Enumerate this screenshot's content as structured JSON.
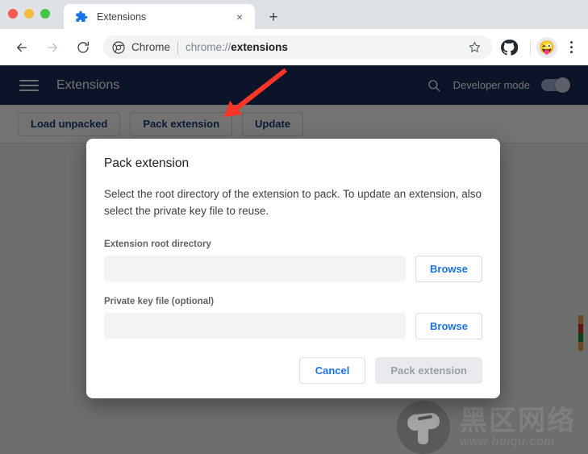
{
  "window": {
    "traffic_lights": [
      "close",
      "minimize",
      "maximize"
    ]
  },
  "tabstrip": {
    "tab": {
      "favicon": "puzzle-piece-icon",
      "title": "Extensions",
      "close_label": "×"
    },
    "new_tab_label": "+"
  },
  "navbar": {
    "back_label": "←",
    "forward_label": "→",
    "reload_label": "⟳",
    "omnibox": {
      "chrome_icon": "chrome-logo-icon",
      "chrome_label": "Chrome",
      "url_scheme": "chrome://",
      "url_host": "extensions",
      "full_url": "chrome://extensions",
      "star_icon": "bookmark-star-icon"
    },
    "github_icon": "github-icon",
    "avatar_emoji": "😜",
    "menu_icon": "three-dot-menu-icon"
  },
  "extensions_page": {
    "header": {
      "menu_icon": "hamburger-menu-icon",
      "title": "Extensions",
      "search_icon": "search-icon",
      "developer_mode_label": "Developer mode",
      "developer_mode_on": true
    },
    "toolbar": {
      "load_unpacked_label": "Load unpacked",
      "pack_extension_label": "Pack extension",
      "update_label": "Update"
    }
  },
  "annotation": {
    "arrow_color": "#f83628",
    "points_to": "Pack extension"
  },
  "dialog": {
    "title": "Pack extension",
    "description": "Select the root directory of the extension to pack. To update an extension, also select the private key file to reuse.",
    "fields": [
      {
        "label": "Extension root directory",
        "value": "",
        "placeholder": "",
        "browse_label": "Browse"
      },
      {
        "label": "Private key file (optional)",
        "value": "",
        "placeholder": "",
        "browse_label": "Browse"
      }
    ],
    "cancel_label": "Cancel",
    "confirm_label": "Pack extension",
    "confirm_disabled": true
  },
  "watermark": {
    "logo": "mushroom-logo-icon",
    "title_cn": "黑区网络",
    "url": "www.heiqu.com"
  },
  "colors": {
    "header_navy": "#1a2e5a",
    "accent_blue": "#1a73e8",
    "toolbar_link": "#1a3a7a",
    "page_bg": "#f1f3f4",
    "arrow_red": "#f83628"
  }
}
